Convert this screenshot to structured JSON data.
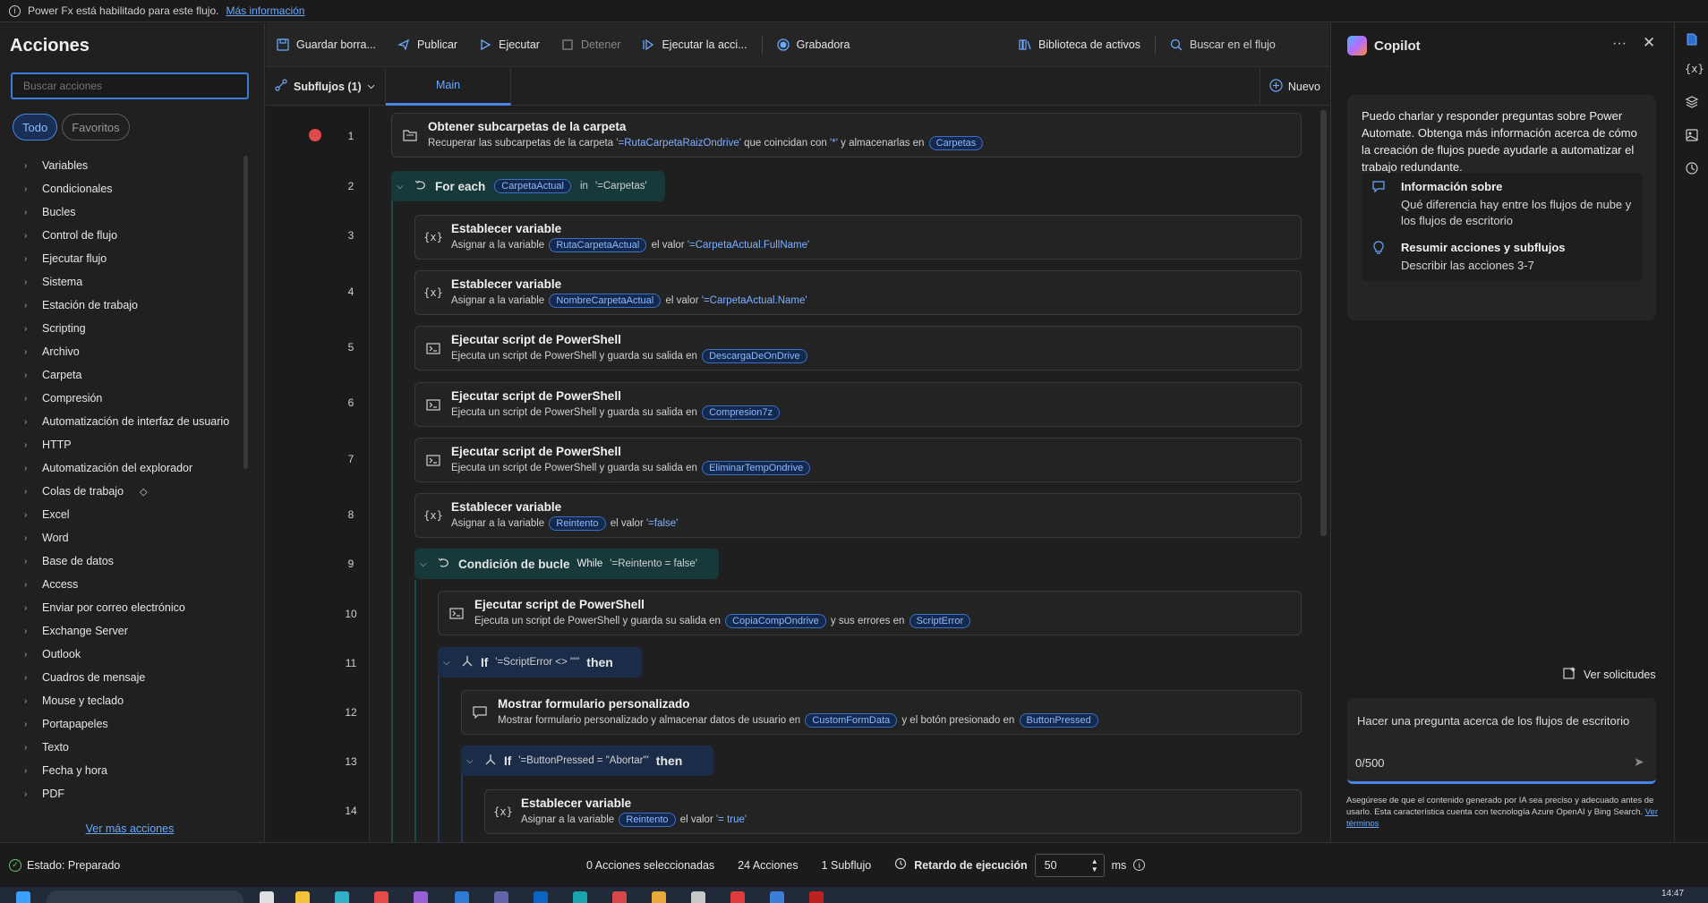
{
  "banner": {
    "text": "Power Fx está habilitado para este flujo.",
    "link": "Más información"
  },
  "actions": {
    "title": "Acciones",
    "search_placeholder": "Buscar acciones",
    "filters": [
      "Todo",
      "Favoritos"
    ],
    "categories": [
      "Variables",
      "Condicionales",
      "Bucles",
      "Control de flujo",
      "Ejecutar flujo",
      "Sistema",
      "Estación de trabajo",
      "Scripting",
      "Archivo",
      "Carpeta",
      "Compresión",
      "Automatización de interfaz de usuario",
      "HTTP",
      "Automatización del explorador",
      "Colas de trabajo",
      "Excel",
      "Word",
      "Base de datos",
      "Access",
      "Enviar por correo electrónico",
      "Exchange Server",
      "Outlook",
      "Cuadros de mensaje",
      "Mouse y teclado",
      "Portapapeles",
      "Texto",
      "Fecha y hora",
      "PDF"
    ],
    "more": "Ver más acciones"
  },
  "toolbar": {
    "save": "Guardar borra...",
    "publish": "Publicar",
    "run": "Ejecutar",
    "stop": "Detener",
    "run_action": "Ejecutar la acci...",
    "recorder": "Grabadora",
    "assets": "Biblioteca de activos",
    "search_flow": "Buscar en el flujo"
  },
  "subbar": {
    "subflows": "Subflujos (1)",
    "main_tab": "Main",
    "new": "Nuevo"
  },
  "steps": {
    "s1": {
      "title": "Obtener subcarpetas de la carpeta",
      "d1": "Recuperar las subcarpetas de la carpeta",
      "q1": "'=RutaCarpetaRaizOndrive'",
      "d2": "que coincidan con",
      "q2": "'*'",
      "d3": "y almacenarlas en",
      "v1": "Carpetas"
    },
    "s2": {
      "title": "For each",
      "v1": "CarpetaActual",
      "d1": "in",
      "q1": "'=Carpetas'"
    },
    "s3": {
      "title": "Establecer variable",
      "d1": "Asignar a la variable",
      "v1": "RutaCarpetaActual",
      "d2": "el valor",
      "q1": "'=CarpetaActual.FullName'"
    },
    "s4": {
      "title": "Establecer variable",
      "d1": "Asignar a la variable",
      "v1": "NombreCarpetaActual",
      "d2": "el valor",
      "q1": "'=CarpetaActual.Name'"
    },
    "s5": {
      "title": "Ejecutar script de PowerShell",
      "d1": "Ejecuta un script de PowerShell y guarda su salida en",
      "v1": "DescargaDeOnDrive"
    },
    "s6": {
      "title": "Ejecutar script de PowerShell",
      "d1": "Ejecuta un script de PowerShell y guarda su salida en",
      "v1": "Compresion7z"
    },
    "s7": {
      "title": "Ejecutar script de PowerShell",
      "d1": "Ejecuta un script de PowerShell y guarda su salida en",
      "v1": "EliminarTempOndrive"
    },
    "s8": {
      "title": "Establecer variable",
      "d1": "Asignar a la variable",
      "v1": "Reintento",
      "d2": "el valor",
      "q1": "'=false'"
    },
    "s9": {
      "title": "Condición de bucle",
      "d1": "While",
      "q1": "'=Reintento = false'"
    },
    "s10": {
      "title": "Ejecutar script de PowerShell",
      "d1": "Ejecuta un script de PowerShell y guarda su salida en",
      "v1": "CopiaCompOndrive",
      "d2": "y sus errores en",
      "v2": "ScriptError"
    },
    "s11": {
      "title": "If",
      "q1": "'=ScriptError <> \"\"'",
      "then": "then"
    },
    "s12": {
      "title": "Mostrar formulario personalizado",
      "d1": "Mostrar formulario personalizado y almacenar datos de usuario en",
      "v1": "CustomFormData",
      "d2": "y el botón presionado en",
      "v2": "ButtonPressed"
    },
    "s13": {
      "title": "If",
      "q1": "'=ButtonPressed = \"Abortar\"'",
      "then": "then"
    },
    "s14": {
      "title": "Establecer variable",
      "d1": "Asignar a la variable",
      "v1": "Reintento",
      "d2": "el valor",
      "q1": "'= true'"
    }
  },
  "line_numbers": [
    "1",
    "2",
    "3",
    "4",
    "5",
    "6",
    "7",
    "8",
    "9",
    "10",
    "11",
    "12",
    "13",
    "14"
  ],
  "copilot": {
    "title": "Copilot",
    "intro": "Puedo charlar y responder preguntas sobre Power Automate. Obtenga más información acerca de cómo la creación de flujos puede ayudarle a automatizar el trabajo redundante.",
    "sugg1_title": "Información sobre",
    "sugg1_desc": "Qué diferencia hay entre los flujos de nube y los flujos de escritorio",
    "sugg2_title": "Resumir acciones y subflujos",
    "sugg2_desc": "Describir las acciones 3-7",
    "requests": "Ver solicitudes",
    "placeholder": "Hacer una pregunta acerca de los flujos de escritorio",
    "counter": "0/500",
    "disclaimer": "Asegúrese de que el contenido generado por IA sea preciso y adecuado antes de usarlo. Esta característica cuenta con tecnología Azure OpenAI y Bing Search.",
    "terms": "Ver términos"
  },
  "status": {
    "state": "Estado: Preparado",
    "selected": "0 Acciones seleccionadas",
    "actions": "24 Acciones",
    "subflows": "1 Subflujo",
    "delay_label": "Retardo de ejecución",
    "delay_value": "50",
    "unit": "ms"
  },
  "clock": "14:47"
}
